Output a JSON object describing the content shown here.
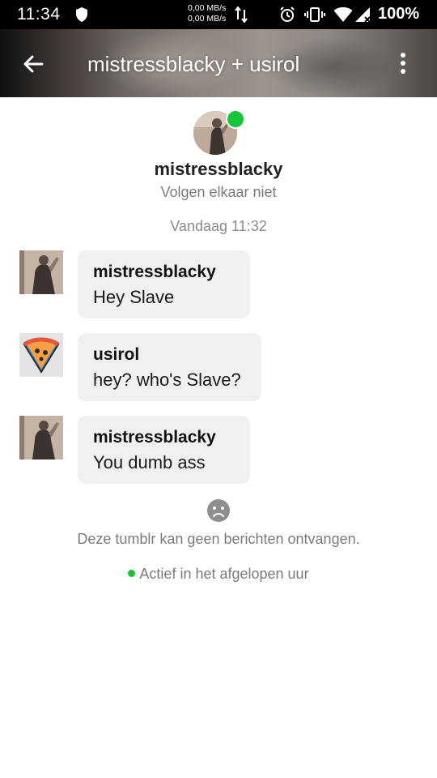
{
  "status_bar": {
    "time": "11:34",
    "net_up": "0,00 MB/s",
    "net_down": "0,00 MB/s",
    "battery": "100%",
    "icons": [
      "shield-icon",
      "data-arrows-icon",
      "alarm-icon",
      "vibrate-icon",
      "wifi-icon",
      "signal-icon"
    ]
  },
  "header": {
    "title": "mistressblacky + usirol",
    "back_icon": "arrow-left-icon",
    "menu_icon": "more-vert-icon"
  },
  "profile": {
    "name": "mistressblacky",
    "follow_status": "Volgen elkaar niet",
    "online": true
  },
  "conversation": {
    "timestamp": "Vandaag 11:32",
    "messages": [
      {
        "sender": "mistressblacky",
        "text": "Hey Slave",
        "avatar": "photo"
      },
      {
        "sender": "usirol",
        "text": "hey? who's Slave?",
        "avatar": "pizza-icon"
      },
      {
        "sender": "mistressblacky",
        "text": "You dumb ass",
        "avatar": "photo"
      }
    ]
  },
  "footer": {
    "sad_icon": "sad-face-icon",
    "cannot_receive": "Deze tumblr kan geen berichten ontvangen.",
    "active_status": "Actief in het afgelopen uur"
  },
  "colors": {
    "online_green": "#18c538",
    "bubble_bg": "#f0f0f0",
    "muted_text": "#7b7b7b"
  }
}
